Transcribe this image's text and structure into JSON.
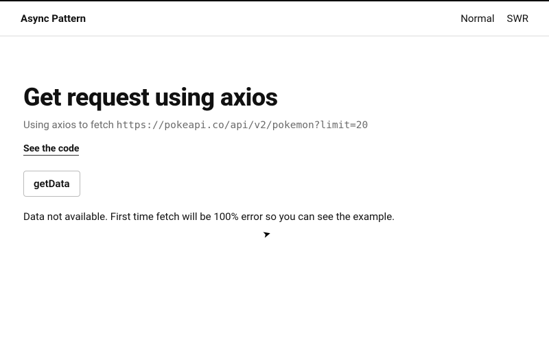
{
  "header": {
    "brand": "Async Pattern",
    "nav": [
      {
        "label": "Normal"
      },
      {
        "label": "SWR"
      }
    ]
  },
  "main": {
    "title": "Get request using axios",
    "subtitle_prefix": "Using axios to fetch ",
    "subtitle_url": "https://pokeapi.co/api/v2/pokemon?limit=20",
    "see_code_label": "See the code",
    "button_label": "getData",
    "message": "Data not available. First time fetch will be 100% error so you can see the example."
  }
}
